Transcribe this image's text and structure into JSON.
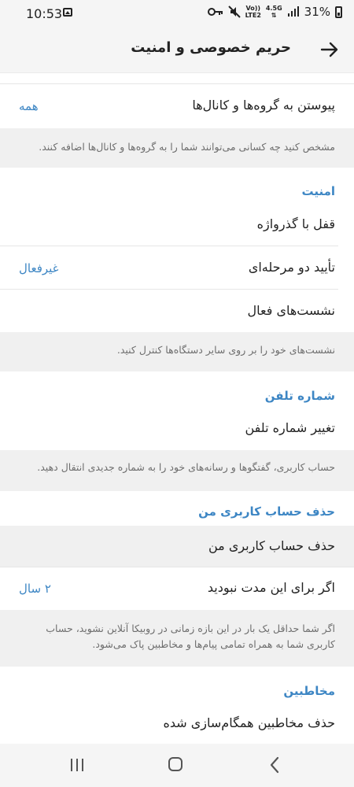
{
  "status_bar": {
    "time": "10:53",
    "network_top": "Vo))",
    "network_bottom": "LTE2",
    "data_top": "4.5G",
    "battery": "31%"
  },
  "app_bar": {
    "title": "حریم خصوصی و امنیت"
  },
  "groups_row": {
    "label": "پیوستن به گروه‌ها و کانال‌ها",
    "value": "همه",
    "info": "مشخص کنید چه کسانی می‌توانند شما را به گروه‌ها و کانال‌ها اضافه کنند."
  },
  "security": {
    "title": "امنیت",
    "passcode_label": "قفل با گذرواژه",
    "two_step_label": "تأیید دو مرحله‌ای",
    "two_step_value": "غیرفعال",
    "sessions_label": "نشست‌های فعال",
    "info": "نشست‌های خود را بر روی سایر دستگاه‌ها کنترل کنید."
  },
  "phone": {
    "title": "شماره تلفن",
    "change_label": "تغییر شماره تلفن",
    "info": "حساب کاربری، گفتگوها و رسانه‌های خود را به شماره جدیدی انتقال دهید."
  },
  "delete_account": {
    "title": "حذف حساب کاربری من",
    "delete_label": "حذف حساب کاربری من",
    "inactive_label": "اگر برای این مدت نبودید",
    "inactive_value": "۲ سال",
    "info_line1": "اگر شما حداقل یک بار در این بازه زمانی در روبیکا آنلاین نشوید، حساب",
    "info_line2": "کاربری شما به همراه تمامی پیام‌ها و مخاطبین پاک می‌شود."
  },
  "contacts": {
    "title": "مخاطبین",
    "delete_synced_label": "حذف مخاطبین همگام‌سازی شده"
  },
  "icons": {
    "back": "arrow-right-icon",
    "home": "home-icon",
    "recents": "recents-icon",
    "nav_back": "chevron-left-icon"
  },
  "colors": {
    "accent": "#3d86c4",
    "info_bg": "#f0f0f0",
    "bar_bg": "#f5f5f5"
  }
}
